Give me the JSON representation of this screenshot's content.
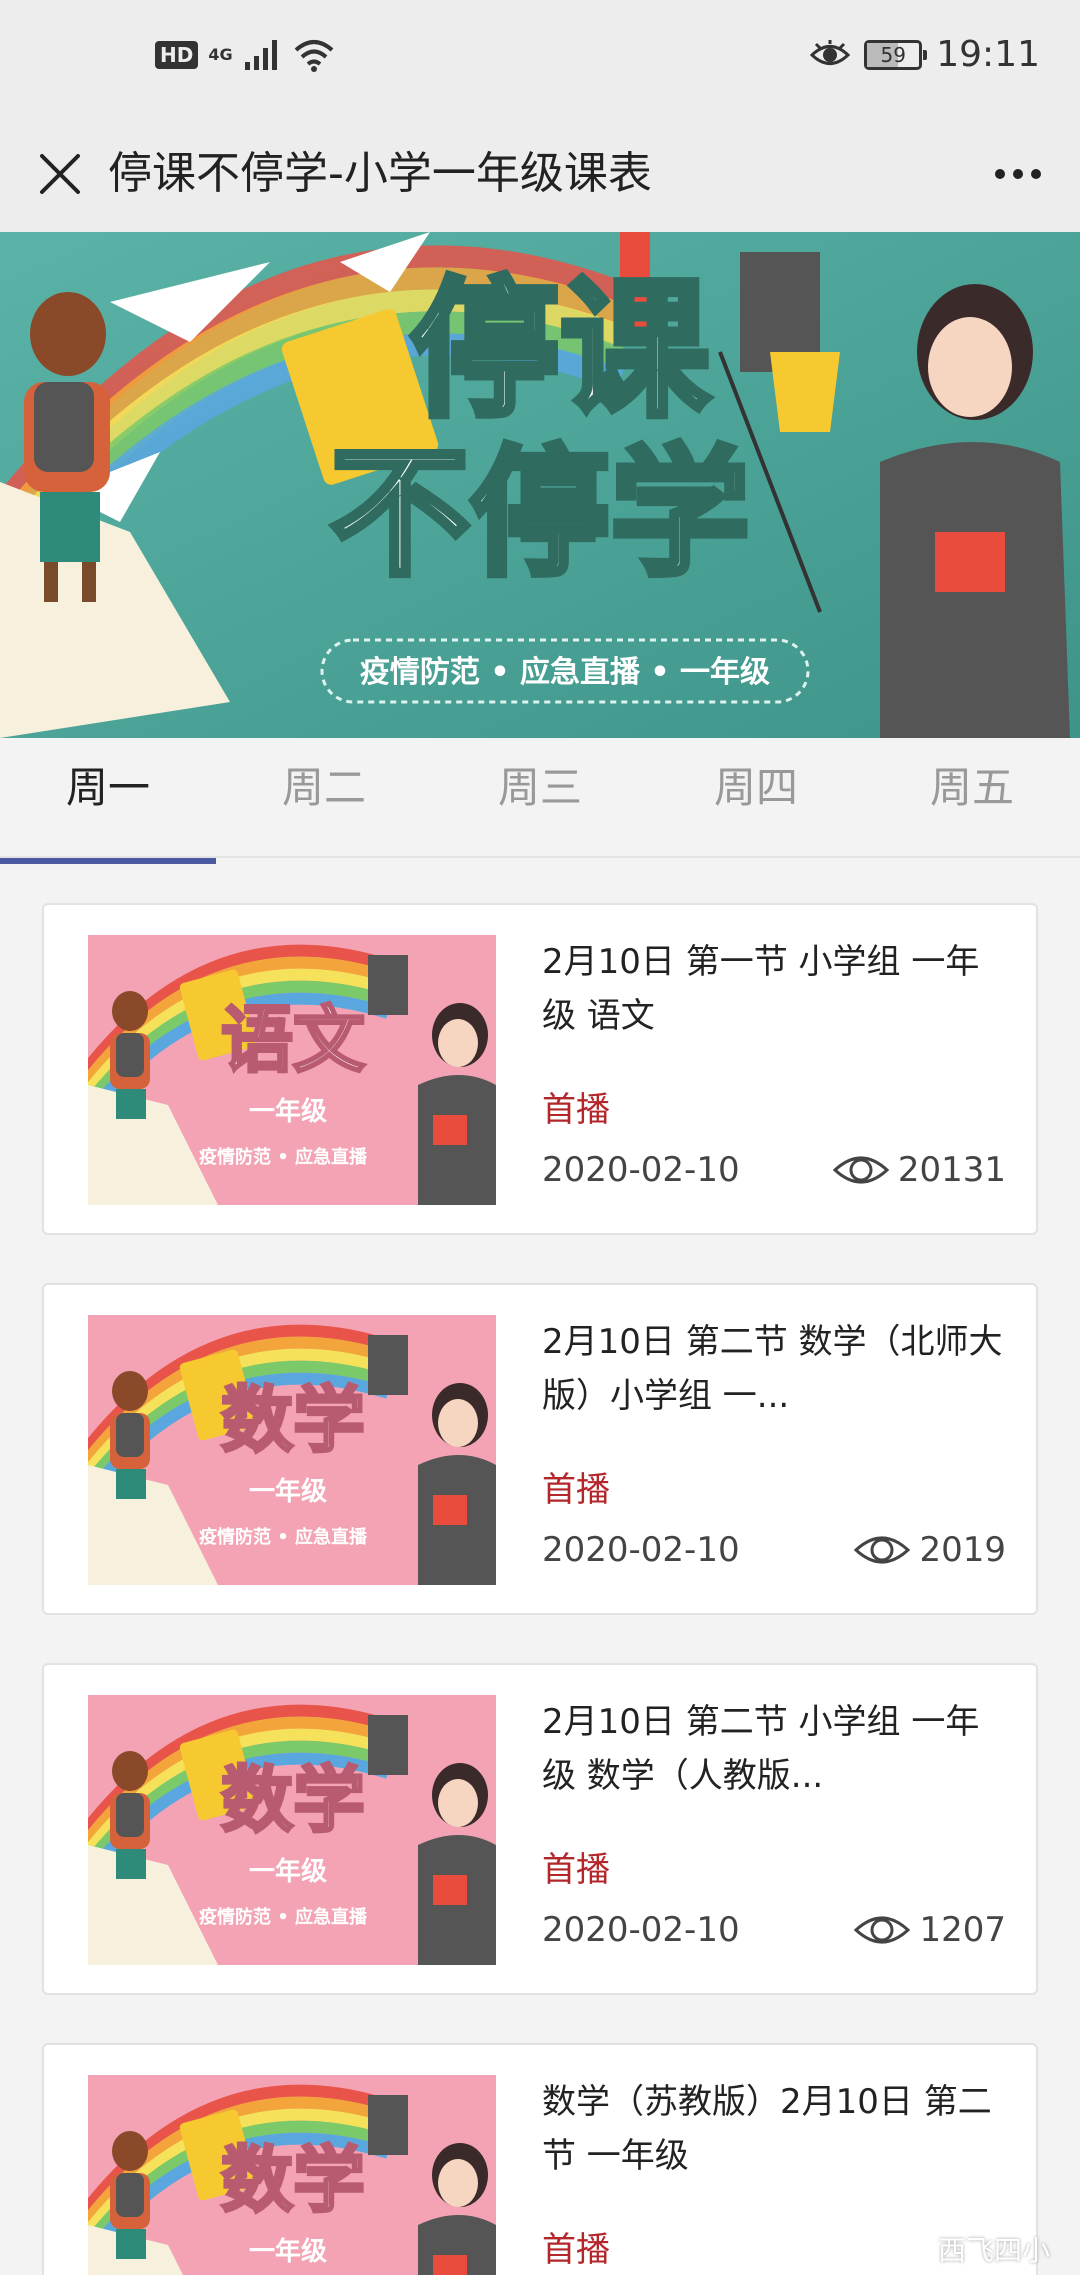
{
  "status_bar": {
    "hd": "HD",
    "network": "4G",
    "battery": "59",
    "time": "19:11"
  },
  "nav": {
    "title": "停课不停学-小学一年级课表"
  },
  "banner": {
    "line1": "停课",
    "line2": "不停学",
    "tagline": "疫情防范 • 应急直播 • 一年级"
  },
  "tabs": [
    {
      "label": "周一",
      "active": true
    },
    {
      "label": "周二",
      "active": false
    },
    {
      "label": "周三",
      "active": false
    },
    {
      "label": "周四",
      "active": false
    },
    {
      "label": "周五",
      "active": false
    }
  ],
  "cards": [
    {
      "thumb_subject": "语文",
      "thumb_grade": "一年级",
      "thumb_tagline": "疫情防范 • 应急直播",
      "title": "2月10日 第一节 小学组 一年级 语文",
      "tag": "首播",
      "date": "2020-02-10",
      "views": "20131"
    },
    {
      "thumb_subject": "数学",
      "thumb_grade": "一年级",
      "thumb_tagline": "疫情防范 • 应急直播",
      "title": "2月10日 第二节 数学（北师大版）小学组 一...",
      "tag": "首播",
      "date": "2020-02-10",
      "views": "2019"
    },
    {
      "thumb_subject": "数学",
      "thumb_grade": "一年级",
      "thumb_tagline": "疫情防范 • 应急直播",
      "title": "2月10日 第二节 小学组 一年级 数学（人教版...",
      "tag": "首播",
      "date": "2020-02-10",
      "views": "1207"
    },
    {
      "thumb_subject": "数学",
      "thumb_grade": "一年级",
      "thumb_tagline": "",
      "title": "数学（苏教版）2月10日 第二节 一年级",
      "tag": "首播",
      "date": "",
      "views": ""
    }
  ],
  "watermark": "西飞四小",
  "colors": {
    "accent_tab": "#4b5aa0",
    "tag_red": "#b3262a",
    "banner_teal": "#4fa69a",
    "thumb_pink": "#f4a3b4"
  }
}
